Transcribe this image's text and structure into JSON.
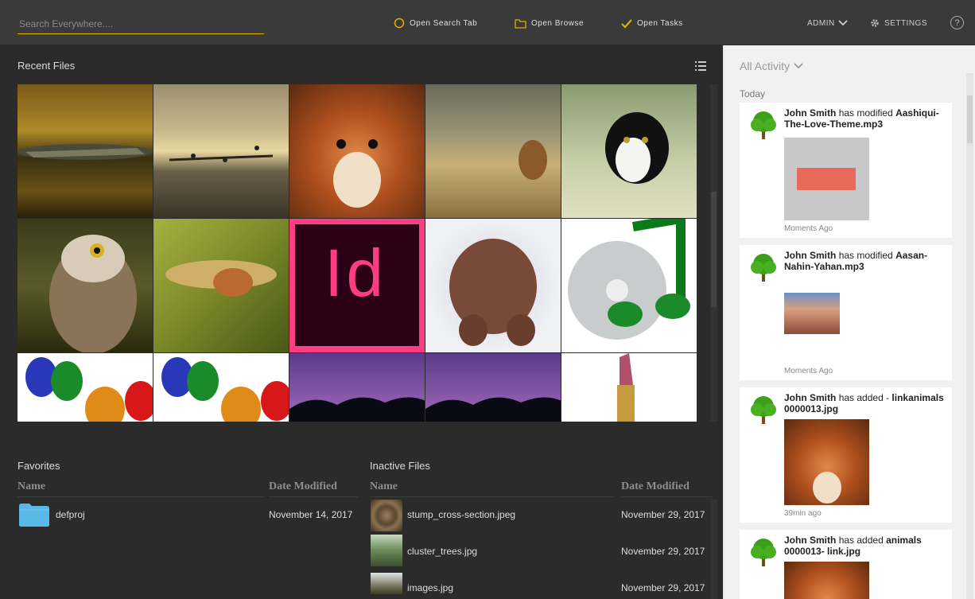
{
  "topbar": {
    "search_placeholder": "Search Everywhere....",
    "open_search_tab": "Open Search Tab",
    "open_browse": "Open Browse",
    "open_tasks": "Open Tasks",
    "admin": "ADMIN",
    "settings": "SETTINGS",
    "help": "?",
    "accent_color": "#d8b400"
  },
  "recent": {
    "title": "Recent Files",
    "tiles": [
      "alligator",
      "birds-beach",
      "squirrel",
      "dog-field",
      "cat",
      "owl",
      "mouse-wheat",
      "indesign-file",
      "spiky-figure",
      "music-cd",
      "colored-glass-trees",
      "colored-glass-trees",
      "palm-sunset",
      "palm-sunset",
      "lipstick"
    ]
  },
  "favorites": {
    "title": "Favorites",
    "col_name": "Name",
    "col_date": "Date Modified",
    "rows": [
      {
        "name": "defproj",
        "date": "November 14, 2017"
      }
    ]
  },
  "inactive": {
    "title": "Inactive Files",
    "col_name": "Name",
    "col_date": "Date Modified",
    "rows": [
      {
        "name": "stump_cross-section.jpeg",
        "date": "November 29, 2017"
      },
      {
        "name": "cluster_trees.jpg",
        "date": "November 29, 2017"
      },
      {
        "name": "images.jpg",
        "date": "November 29, 2017"
      }
    ]
  },
  "activity": {
    "filter": "All Activity",
    "today": "Today",
    "items": [
      {
        "user": "John Smith",
        "action": "has modified",
        "file": "Aashiqui-The-Love-Theme.mp3",
        "time": "Moments Ago"
      },
      {
        "user": "John Smith",
        "action": "has modified",
        "file": "Aasan-Nahin-Yahan.mp3",
        "time": "Moments Ago"
      },
      {
        "user": "John Smith",
        "action": "has added -",
        "file": "linkanimals 0000013.jpg",
        "time": "39min ago"
      },
      {
        "user": "John Smith",
        "action": "has added",
        "file": "animals 0000013- link.jpg",
        "time": ""
      }
    ]
  }
}
